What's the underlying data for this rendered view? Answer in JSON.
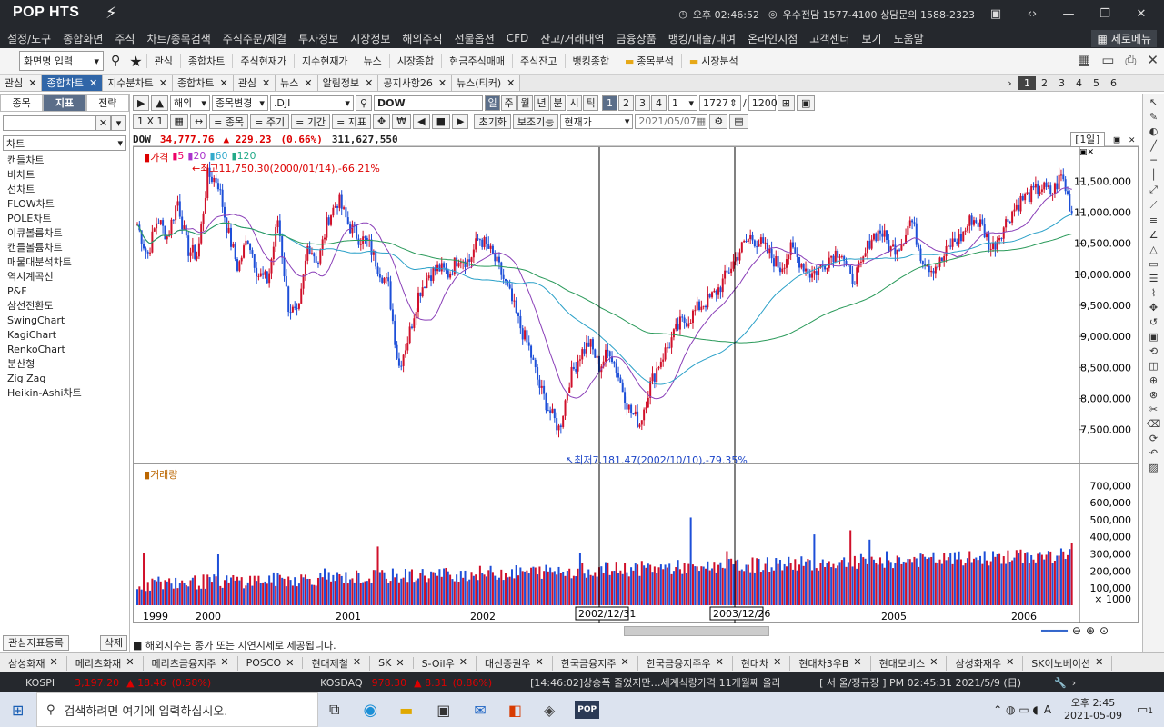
{
  "title_bar": {
    "logo": "POP HTS",
    "time_label": "오후 02:46:52",
    "contact": "우수전담 1577-4100 상담문의 1588-2323"
  },
  "menu": [
    "설정/도구",
    "종합화면",
    "주식",
    "차트/종목검색",
    "주식주문/체결",
    "투자정보",
    "시장정보",
    "해외주식",
    "선물옵션",
    "CFD",
    "잔고/거래내역",
    "금융상품",
    "뱅킹/대출/대여",
    "온라인지점",
    "고객센터",
    "보기",
    "도움말"
  ],
  "menu_right": "세로메뉴",
  "toolbar": {
    "screen_input": "화면명 입력",
    "items": [
      "관심",
      "종합차트",
      "주식현재가",
      "지수현재가",
      "뉴스",
      "시장종합",
      "현금주식매매",
      "주식잔고",
      "뱅킹종합"
    ],
    "folders": [
      "종목분석",
      "시장분석"
    ]
  },
  "tabs": [
    "관심",
    "종합차트",
    "지수분차트",
    "종합차트",
    "관심",
    "뉴스",
    "알림정보",
    "공지사항26",
    "뉴스(티커)"
  ],
  "page_numbers": [
    "1",
    "2",
    "3",
    "4",
    "5",
    "6"
  ],
  "left_panel": {
    "tabs": [
      "종목",
      "지표",
      "전략"
    ],
    "select": "차트",
    "items": [
      "캔들차트",
      "바차트",
      "선차트",
      "FLOW차트",
      "POLE차트",
      "이큐볼륨차트",
      "캔들볼륨차트",
      "매물대분석차트",
      "역시계곡선",
      "P&F",
      "삼선전환도",
      "SwingChart",
      "KagiChart",
      "RenkoChart",
      "분산형",
      "Zig Zag",
      "Heikin-Ashi차트"
    ],
    "register_btn": "관심지표등록",
    "delete_btn": "삭제"
  },
  "controls": {
    "market": "해외",
    "change": "종목변경",
    "code": ".DJI",
    "name": "DOW",
    "periods": [
      "일",
      "주",
      "월",
      "년",
      "분",
      "시",
      "틱"
    ],
    "nums": [
      "1",
      "2",
      "3",
      "4"
    ],
    "interval": "1",
    "count": "1727",
    "total": "1200",
    "row2": [
      "1 X 1",
      "= 종목",
      "= 주기",
      "= 기간",
      "= 지표"
    ],
    "reset": "초기화",
    "aux": "보조기능",
    "price_type": "현재가",
    "date": "2021/05/07"
  },
  "quote": {
    "name": "DOW",
    "price": "34,777.76",
    "change": "▲ 229.23",
    "pct": "(0.66%)",
    "volume": "311,627,550",
    "period": "1일"
  },
  "price_legend": {
    "label": "가격",
    "ma": [
      "5",
      "20",
      "60",
      "120"
    ],
    "high_note": "최고11,750.30(2000/01/14),-66.21%",
    "low_note": "최저7,181.47(2002/10/10),-79.35%"
  },
  "volume_legend": "거래량",
  "crosshair_labels": [
    "2002/12/31",
    "2003/12/26"
  ],
  "x_ticks": [
    "1999",
    "2000",
    "2001",
    "2002",
    "2005",
    "2006"
  ],
  "status_note": "해외지수는 종가 또는 지연시세로 제공됩니다.",
  "stock_tabs": [
    "삼성화재",
    "메리츠화재",
    "메리츠금융지주",
    "POSCO",
    "현대제철",
    "SK",
    "S-Oil우",
    "대신증권우",
    "한국금융지주",
    "한국금융지주우",
    "현대차",
    "현대차3우B",
    "현대모비스",
    "삼성화재우",
    "SK이노베이션"
  ],
  "ticker": {
    "kospi_label": "KOSPI",
    "kospi": "3,197.20",
    "kospi_chg": "▲ 18.46",
    "kospi_pct": "(0.58%)",
    "kosdaq_label": "KOSDAQ",
    "kosdaq": "978.30",
    "kosdaq_chg": "▲ 8.31",
    "kosdaq_pct": "(0.86%)",
    "news": "[14:46:02]상승폭 줄었지만…세계식량가격 11개월째 올라",
    "session": "[ 서  울/정규장 ] PM 02:45:31  2021/5/9 (日)"
  },
  "taskbar": {
    "search_placeholder": "검색하려면 여기에 입력하십시오.",
    "time": "오후 2:45",
    "date": "2021-05-09",
    "lang": "A",
    "notif": "1"
  },
  "chart_data": {
    "type": "candlestick",
    "title": "DOW",
    "y_ticks": [
      11500,
      11000,
      10500,
      10000,
      9500,
      9000,
      8500,
      8000,
      7500
    ],
    "ylim": [
      7100,
      11900
    ],
    "vol_ticks": [
      700000,
      600000,
      500000,
      400000,
      300000,
      200000,
      100000
    ],
    "vol_unit": "× 1000",
    "closes": [
      10800,
      10300,
      10900,
      10600,
      11200,
      10400,
      10300,
      11600,
      11500,
      10700,
      10100,
      10600,
      10000,
      9900,
      10900,
      9500,
      9300,
      10500,
      10200,
      10900,
      11200,
      10800,
      10600,
      10500,
      10100,
      9800,
      8500,
      9000,
      9700,
      10000,
      10100,
      10000,
      10300,
      10200,
      10600,
      10400,
      10100,
      9700,
      9200,
      8800,
      8200,
      7800,
      7500,
      8300,
      8700,
      8900,
      8500,
      8800,
      8300,
      7800,
      7600,
      8200,
      8600,
      8900,
      9200,
      9300,
      9500,
      9600,
      9800,
      10100,
      10400,
      10600,
      10500,
      10300,
      10100,
      10400,
      10200,
      10000,
      10100,
      10300,
      10400,
      9900,
      10100,
      10600,
      10700,
      10400,
      10500,
      10900,
      10300,
      10100,
      10200,
      10500,
      10600,
      10900,
      10800,
      10400,
      10700,
      11000,
      11200,
      11300,
      11400,
      11300,
      11600,
      11000
    ]
  }
}
